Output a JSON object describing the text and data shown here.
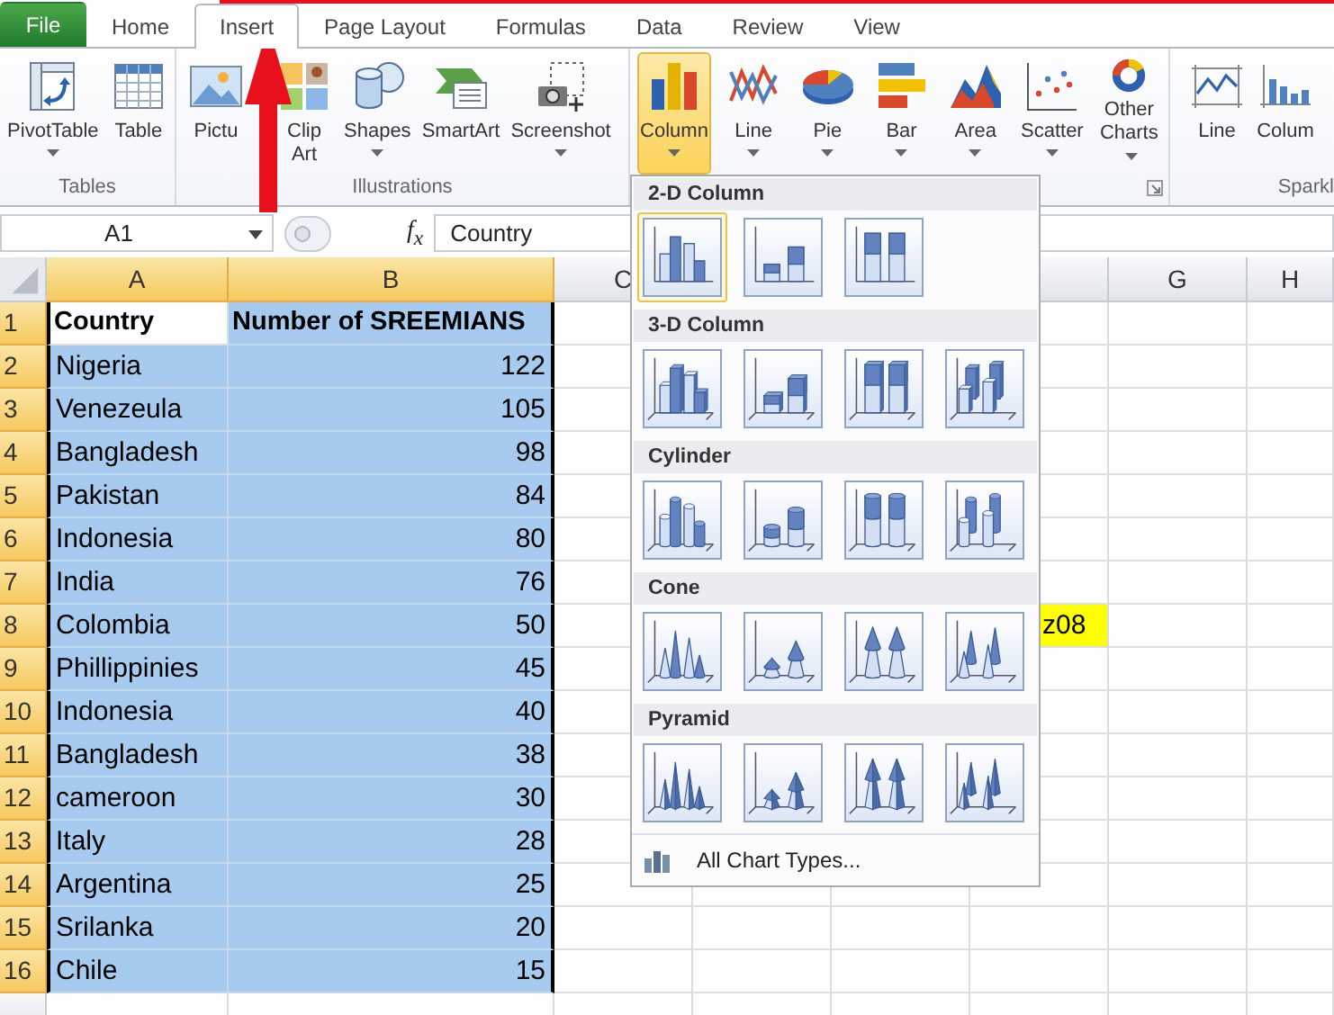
{
  "ribbon_tabs": [
    {
      "label": "File",
      "kind": "file",
      "selected": false
    },
    {
      "label": "Home",
      "kind": "tab",
      "selected": false
    },
    {
      "label": "Insert",
      "kind": "tab",
      "selected": true
    },
    {
      "label": "Page Layout",
      "kind": "tab",
      "selected": false
    },
    {
      "label": "Formulas",
      "kind": "tab",
      "selected": false
    },
    {
      "label": "Data",
      "kind": "tab",
      "selected": false
    },
    {
      "label": "Review",
      "kind": "tab",
      "selected": false
    },
    {
      "label": "View",
      "kind": "tab",
      "selected": false
    }
  ],
  "ribbon_groups": [
    {
      "label": "Tables",
      "launcher": false,
      "buttons": [
        {
          "label": "PivotTable",
          "dropdown": true,
          "selected": false
        },
        {
          "label": "Table",
          "dropdown": false,
          "selected": false
        }
      ]
    },
    {
      "label": "Illustrations",
      "launcher": false,
      "buttons": [
        {
          "label": "Pictu",
          "dropdown": false,
          "selected": false
        },
        {
          "label": "Clip Art",
          "dropdown": false,
          "selected": false
        },
        {
          "label": "Shapes",
          "dropdown": true,
          "selected": false
        },
        {
          "label": "SmartArt",
          "dropdown": false,
          "selected": false
        },
        {
          "label": "Screenshot",
          "dropdown": true,
          "selected": false
        }
      ]
    },
    {
      "launcher": true,
      "buttons": [
        {
          "label": "Column",
          "dropdown": true,
          "selected": true
        },
        {
          "label": "Line",
          "dropdown": true,
          "selected": false
        },
        {
          "label": "Pie",
          "dropdown": true,
          "selected": false
        },
        {
          "label": "Bar",
          "dropdown": true,
          "selected": false
        },
        {
          "label": "Area",
          "dropdown": true,
          "selected": false
        },
        {
          "label": "Scatter",
          "dropdown": true,
          "selected": false
        },
        {
          "label": "Other Charts",
          "dropdown": true,
          "selected": false
        }
      ]
    },
    {
      "label": "Sparkl",
      "launcher": false,
      "buttons": [
        {
          "label": "Line",
          "dropdown": false,
          "selected": false
        },
        {
          "label": "Colum",
          "dropdown": false,
          "selected": false
        }
      ]
    }
  ],
  "formula_bar": {
    "name_box": "A1",
    "fx": "f$_{x}$",
    "value": "Country"
  },
  "sheet": {
    "columns": [
      {
        "label": "A",
        "selected": true
      },
      {
        "label": "B",
        "selected": true
      },
      {
        "label": "C",
        "selected": false
      },
      {
        "label": "G",
        "selected": false
      },
      {
        "label": "H",
        "selected": false
      }
    ],
    "rows": [
      {
        "header": "1",
        "kind": "header",
        "selected": true,
        "cells": [
          {
            "text": "Country",
            "active": true
          },
          {
            "text": "Number of SREEMIANS",
            "active": false
          }
        ]
      },
      {
        "header": "2",
        "kind": "data",
        "selected": true,
        "cells": [
          {
            "text": "Nigeria",
            "active": false
          },
          {
            "text": "122",
            "active": false
          }
        ]
      },
      {
        "header": "3",
        "kind": "data",
        "selected": true,
        "cells": [
          {
            "text": "Venezeula",
            "active": false
          },
          {
            "text": "105",
            "active": false
          }
        ]
      },
      {
        "header": "4",
        "kind": "data",
        "selected": true,
        "cells": [
          {
            "text": "Bangladesh",
            "active": false
          },
          {
            "text": "98",
            "active": false
          }
        ]
      },
      {
        "header": "5",
        "kind": "data",
        "selected": true,
        "cells": [
          {
            "text": "Pakistan",
            "active": false
          },
          {
            "text": "84",
            "active": false
          }
        ]
      },
      {
        "header": "6",
        "kind": "data",
        "selected": true,
        "cells": [
          {
            "text": "Indonesia",
            "active": false
          },
          {
            "text": "80",
            "active": false
          }
        ]
      },
      {
        "header": "7",
        "kind": "data",
        "selected": true,
        "cells": [
          {
            "text": "India",
            "active": false
          },
          {
            "text": "76",
            "active": false
          }
        ]
      },
      {
        "header": "8",
        "kind": "data",
        "selected": true,
        "cells": [
          {
            "text": "Colombia",
            "active": false
          },
          {
            "text": "50",
            "active": false
          }
        ],
        "column_f": {
          "text": "z08",
          "highlighted": true
        }
      },
      {
        "header": "9",
        "kind": "data",
        "selected": true,
        "cells": [
          {
            "text": "Phillippinies",
            "active": false
          },
          {
            "text": "45",
            "active": false
          }
        ]
      },
      {
        "header": "10",
        "kind": "data",
        "selected": true,
        "cells": [
          {
            "text": "Indonesia",
            "active": false
          },
          {
            "text": "40",
            "active": false
          }
        ]
      },
      {
        "header": "11",
        "kind": "data",
        "selected": true,
        "cells": [
          {
            "text": "Bangladesh",
            "active": false
          },
          {
            "text": "38",
            "active": false
          }
        ]
      },
      {
        "header": "12",
        "kind": "data",
        "selected": true,
        "cells": [
          {
            "text": "cameroon",
            "active": false
          },
          {
            "text": "30",
            "active": false
          }
        ]
      },
      {
        "header": "13",
        "kind": "data",
        "selected": true,
        "cells": [
          {
            "text": "Italy",
            "active": false
          },
          {
            "text": "28",
            "active": false
          }
        ]
      },
      {
        "header": "14",
        "kind": "data",
        "selected": true,
        "cells": [
          {
            "text": "Argentina",
            "active": false
          },
          {
            "text": "25",
            "active": false
          }
        ]
      },
      {
        "header": "15",
        "kind": "data",
        "selected": true,
        "cells": [
          {
            "text": "Srilanka",
            "active": false
          },
          {
            "text": "20",
            "active": false
          }
        ]
      },
      {
        "header": "16",
        "kind": "data",
        "selected": true,
        "cells": [
          {
            "text": "Chile",
            "active": false
          },
          {
            "text": "15",
            "active": false
          }
        ]
      }
    ]
  },
  "chart_menu": {
    "sections": [
      {
        "title": "2-D Column",
        "kind": "column2d",
        "items": [
          {
            "selected": true
          },
          {
            "selected": false
          },
          {
            "selected": false
          }
        ]
      },
      {
        "title": "3-D Column",
        "kind": "column3d",
        "items": [
          {
            "selected": false
          },
          {
            "selected": false
          },
          {
            "selected": false
          },
          {
            "selected": false
          }
        ]
      },
      {
        "title": "Cylinder",
        "kind": "cylinder",
        "items": [
          {
            "selected": false
          },
          {
            "selected": false
          },
          {
            "selected": false
          },
          {
            "selected": false
          }
        ]
      },
      {
        "title": "Cone",
        "kind": "cone",
        "items": [
          {
            "selected": false
          },
          {
            "selected": false
          },
          {
            "selected": false
          },
          {
            "selected": false
          }
        ]
      },
      {
        "title": "Pyramid",
        "kind": "pyramid",
        "items": [
          {
            "selected": false
          },
          {
            "selected": false
          },
          {
            "selected": false
          },
          {
            "selected": false
          }
        ]
      }
    ],
    "footer": "All Chart Types..."
  }
}
